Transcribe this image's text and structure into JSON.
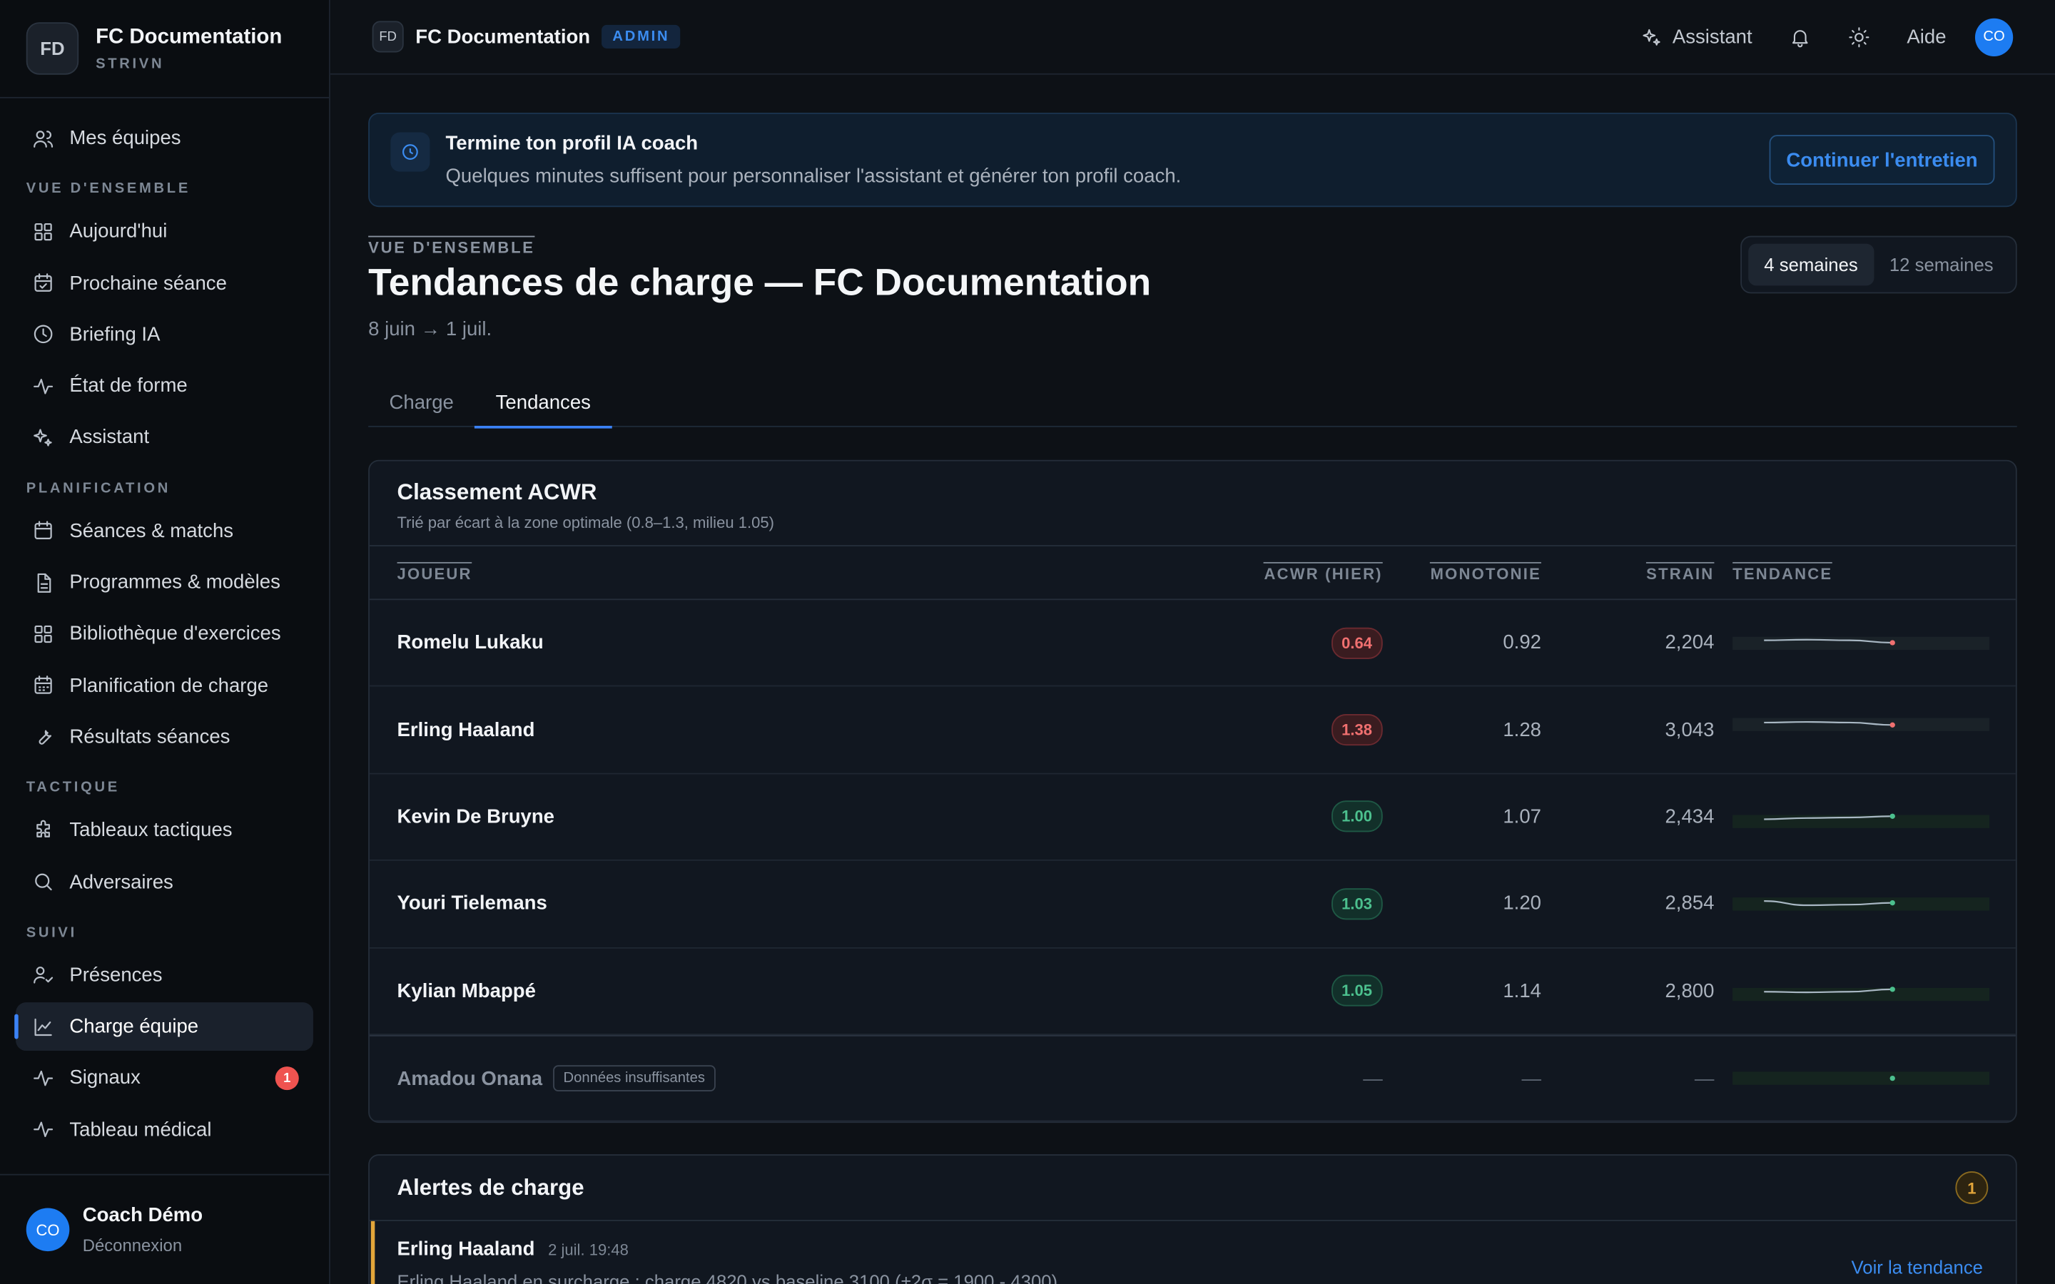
{
  "brand": {
    "badge": "FD",
    "name": "FC Documentation",
    "sub": "STRIVN"
  },
  "sidebar": {
    "top_item": {
      "label": "Mes équipes",
      "icon": "users-icon"
    },
    "sections": [
      {
        "title": "VUE D'ENSEMBLE",
        "items": [
          {
            "label": "Aujourd'hui",
            "icon": "grid-icon"
          },
          {
            "label": "Prochaine séance",
            "icon": "calendar-check-icon"
          },
          {
            "label": "Briefing IA",
            "icon": "clock-icon"
          },
          {
            "label": "État de forme",
            "icon": "activity-icon"
          },
          {
            "label": "Assistant",
            "icon": "sparkles-icon"
          }
        ]
      },
      {
        "title": "PLANIFICATION",
        "items": [
          {
            "label": "Séances & matchs",
            "icon": "calendar-icon"
          },
          {
            "label": "Programmes & modèles",
            "icon": "document-icon"
          },
          {
            "label": "Bibliothèque d'exercices",
            "icon": "grid-icon"
          },
          {
            "label": "Planification de charge",
            "icon": "calendar-grid-icon"
          },
          {
            "label": "Résultats séances",
            "icon": "wrench-icon"
          }
        ]
      },
      {
        "title": "TACTIQUE",
        "items": [
          {
            "label": "Tableaux tactiques",
            "icon": "puzzle-icon"
          },
          {
            "label": "Adversaires",
            "icon": "search-icon"
          }
        ]
      },
      {
        "title": "SUIVI",
        "items": [
          {
            "label": "Présences",
            "icon": "user-check-icon"
          },
          {
            "label": "Charge équipe",
            "icon": "chart-line-icon",
            "active": true
          },
          {
            "label": "Signaux",
            "icon": "activity-icon",
            "badge": "1"
          },
          {
            "label": "Tableau médical",
            "icon": "activity-icon"
          }
        ]
      }
    ]
  },
  "user": {
    "initials": "CO",
    "name": "Coach Démo",
    "logout": "Déconnexion"
  },
  "topbar": {
    "badge": "FD",
    "title": "FC Documentation",
    "role": "ADMIN",
    "assistant_label": "Assistant",
    "help_label": "Aide",
    "avatar": "CO"
  },
  "banner": {
    "title": "Termine ton profil IA coach",
    "desc": "Quelques minutes suffisent pour personnaliser l'assistant et générer ton profil coach.",
    "button": "Continuer l'entretien"
  },
  "page": {
    "eyebrow": "VUE D'ENSEMBLE",
    "title": "Tendances de charge — FC Documentation",
    "date_range": "8 juin → 1 juil.",
    "range_options": [
      "4 semaines",
      "12 semaines"
    ],
    "tabs": [
      "Charge",
      "Tendances"
    ]
  },
  "acwr": {
    "title": "Classement ACWR",
    "subtitle": "Trié par écart à la zone optimale (0.8–1.3, milieu 1.05)",
    "columns": {
      "player": "JOUEUR",
      "acwr": "ACWR (HIER)",
      "monotony": "MONOTONIE",
      "strain": "STRAIN",
      "trend": "TENDANCE"
    },
    "rows": [
      {
        "name": "Romelu Lukaku",
        "acwr": "0.64",
        "status": "red",
        "monotony": "0.92",
        "strain": "2,204",
        "trend": [
          0.55,
          0.56,
          0.55,
          0.51
        ]
      },
      {
        "name": "Erling Haaland",
        "acwr": "1.38",
        "status": "red",
        "monotony": "1.28",
        "strain": "3,043",
        "trend": [
          0.62,
          0.63,
          0.62,
          0.58
        ]
      },
      {
        "name": "Kevin De Bruyne",
        "acwr": "1.00",
        "status": "green",
        "monotony": "1.07",
        "strain": "2,434",
        "trend": [
          0.45,
          0.47,
          0.48,
          0.5
        ]
      },
      {
        "name": "Youri Tielemans",
        "acwr": "1.03",
        "status": "green",
        "monotony": "1.20",
        "strain": "2,854",
        "trend": [
          0.55,
          0.48,
          0.49,
          0.52
        ]
      },
      {
        "name": "Kylian Mbappé",
        "acwr": "1.05",
        "status": "green",
        "monotony": "1.14",
        "strain": "2,800",
        "trend": [
          0.48,
          0.47,
          0.48,
          0.52
        ]
      }
    ],
    "insufficient": {
      "name": "Amadou Onana",
      "tag": "Données insuffisantes",
      "dash": "—"
    }
  },
  "alerts": {
    "title": "Alertes de charge",
    "count": "1",
    "item": {
      "name": "Erling Haaland",
      "time": "2 juil. 19:48",
      "message": "Erling Haaland en surcharge : charge 4820 vs baseline 3100 (±2σ = 1900 - 4300).",
      "link": "Voir la tendance"
    }
  },
  "colors": {
    "accent": "#3b82f6",
    "red": "#f07070",
    "green": "#4cc08e",
    "warn": "#e3a63a"
  }
}
